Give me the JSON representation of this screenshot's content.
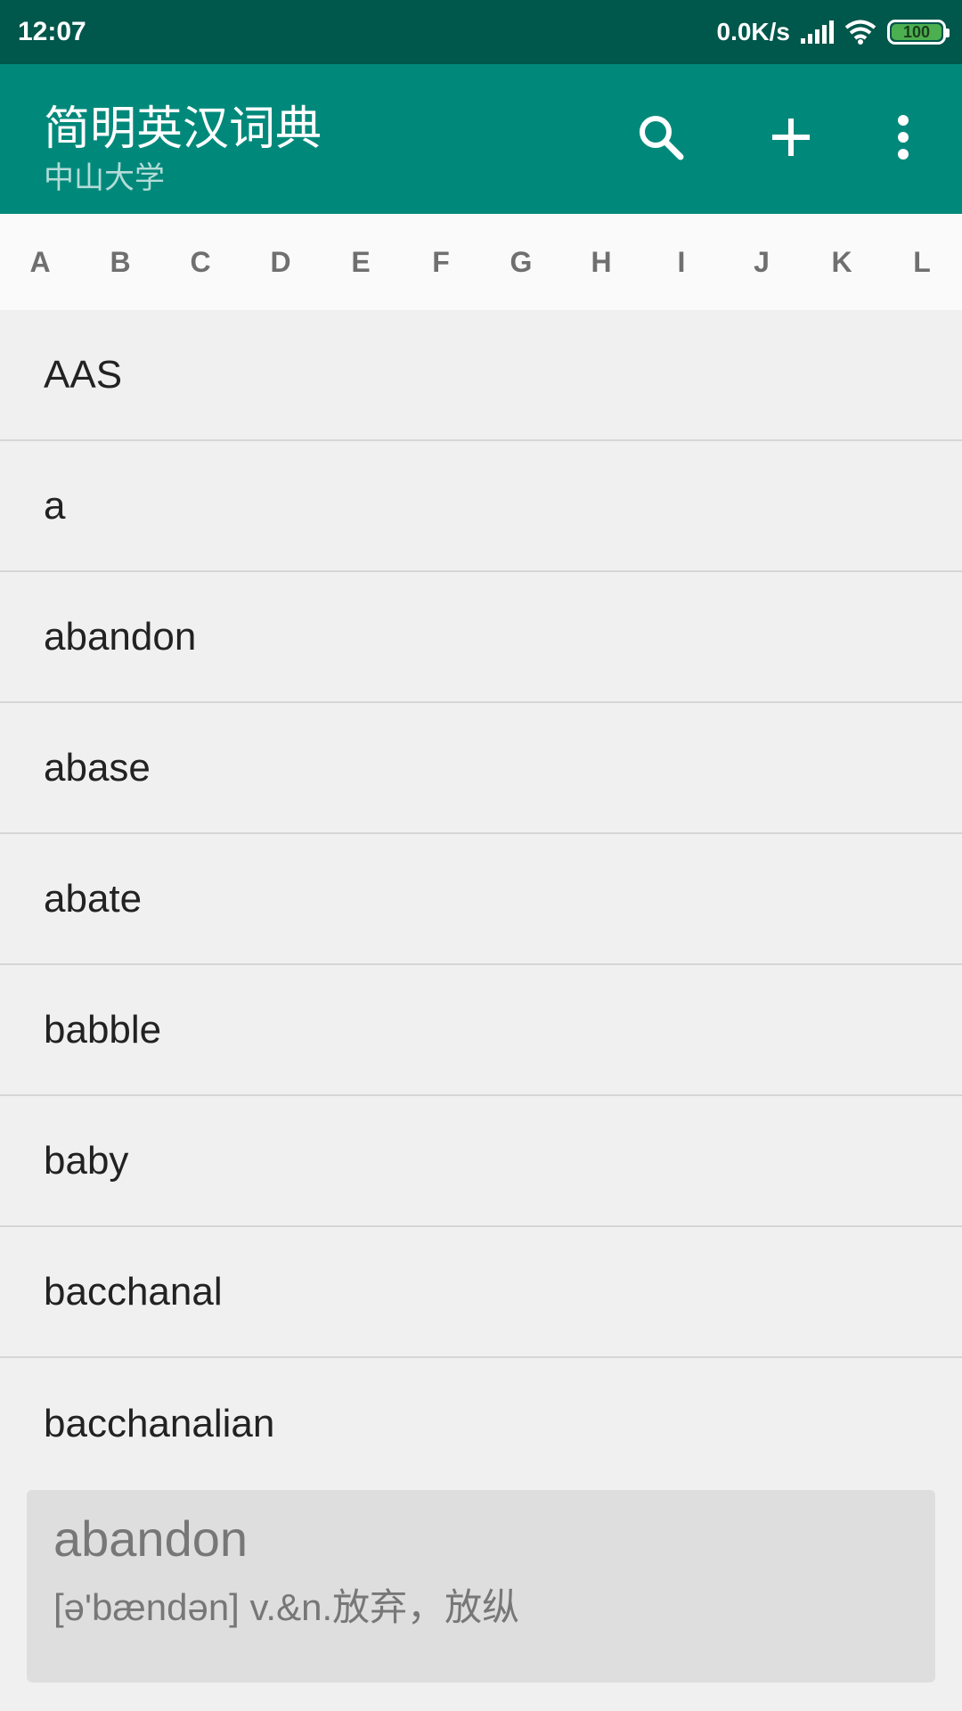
{
  "status_bar": {
    "time": "12:07",
    "net_speed": "0.0K/s",
    "battery": "100"
  },
  "app_bar": {
    "title": "简明英汉词典",
    "subtitle": "中山大学",
    "actions": {
      "search_icon": "search-icon",
      "add_icon": "plus-icon",
      "menu_icon": "more-vert-icon"
    }
  },
  "alphabet": [
    "A",
    "B",
    "C",
    "D",
    "E",
    "F",
    "G",
    "H",
    "I",
    "J",
    "K",
    "L"
  ],
  "words": [
    "AAS",
    "a",
    "abandon",
    "abase",
    "abate",
    "babble",
    "baby",
    "bacchanal",
    "bacchanalian"
  ],
  "preview": {
    "word": "abandon",
    "definition": "[ə'bændən] v.&n.放弃，放纵"
  },
  "colors": {
    "status_bar": "#00574b",
    "app_bar": "#00897b",
    "list_bg": "#f0f0f0",
    "preview_bg": "#dedede"
  }
}
